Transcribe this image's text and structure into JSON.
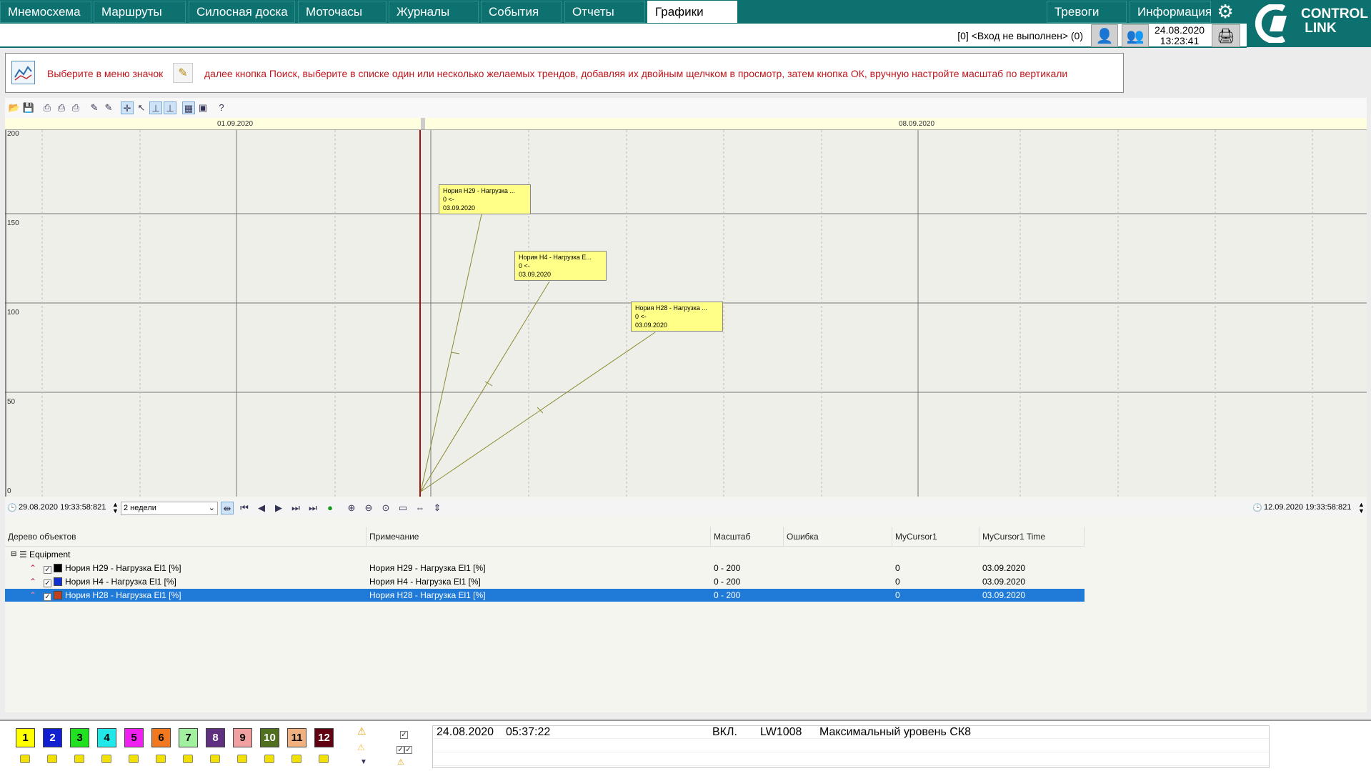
{
  "nav": {
    "tabs": [
      {
        "label": "Мнемосхема"
      },
      {
        "label": "Маршруты"
      },
      {
        "label": "Силосная доска"
      },
      {
        "label": "Моточасы"
      },
      {
        "label": "Журналы"
      },
      {
        "label": "События"
      },
      {
        "label": "Отчеты"
      },
      {
        "label": "Графики"
      }
    ],
    "right_tabs": [
      {
        "label": "Тревоги"
      },
      {
        "label": "Информация"
      }
    ],
    "logo": "CONTROL LINK"
  },
  "status": {
    "login": "[0] <Вход не выполнен> (0)",
    "date": "24.08.2020",
    "time": "13:23:41"
  },
  "hint": {
    "part1": "Выберите в меню значок",
    "part2": "далее кнопка Поиск, выберите в списке один или несколько желаемых трендов, добавляя их двойным щелчком в просмотр, затем кнопка ОК, вручную настройте масштаб по вертикали"
  },
  "chart": {
    "time_labels": [
      "01.09.2020",
      "08.09.2020"
    ],
    "y_ticks": [
      "200",
      "150",
      "100",
      "50",
      "0"
    ],
    "tooltips": [
      {
        "title": "Нория Н29 - Нагрузка ...",
        "value": "0 <-",
        "date": "03.09.2020"
      },
      {
        "title": "Нория Н4 - Нагрузка E...",
        "value": "0 <-",
        "date": "03.09.2020"
      },
      {
        "title": "Нория Н28 - Нагрузка ...",
        "value": "0 <-",
        "date": "03.09.2020"
      }
    ]
  },
  "timectl": {
    "start": "29.08.2020 19:33:58:821",
    "period": "2 недели",
    "end": "12.09.2020 19:33:58:821"
  },
  "table": {
    "headers": [
      "Дерево объектов",
      "Примечание",
      "Масштаб",
      "Ошибка",
      "MyCursor1",
      "MyCursor1 Time"
    ],
    "root": "Equipment",
    "rows": [
      {
        "name": "Нория Н29 - Нагрузка El1 [%]",
        "note": "Нория Н29 - Нагрузка El1 [%]",
        "scale": "0 - 200",
        "error": "",
        "cursor": "0",
        "cursor_time": "03.09.2020",
        "color": "#000000"
      },
      {
        "name": "Нория Н4 - Нагрузка El1 [%]",
        "note": "Нория Н4 - Нагрузка El1 [%]",
        "scale": "0 - 200",
        "error": "",
        "cursor": "0",
        "cursor_time": "03.09.2020",
        "color": "#1030d0"
      },
      {
        "name": "Нория Н28 - Нагрузка El1 [%]",
        "note": "Нория Н28 - Нагрузка El1 [%]",
        "scale": "0 - 200",
        "error": "",
        "cursor": "0",
        "cursor_time": "03.09.2020",
        "color": "#c04020"
      }
    ]
  },
  "footer": {
    "buttons": [
      {
        "label": "1",
        "bg": "#ffff00",
        "fg": "#000"
      },
      {
        "label": "2",
        "bg": "#1020d0",
        "fg": "#fff"
      },
      {
        "label": "3",
        "bg": "#20e020",
        "fg": "#000"
      },
      {
        "label": "4",
        "bg": "#20e8e8",
        "fg": "#000"
      },
      {
        "label": "5",
        "bg": "#f020f0",
        "fg": "#000"
      },
      {
        "label": "6",
        "bg": "#f07820",
        "fg": "#000"
      },
      {
        "label": "7",
        "bg": "#a0f0a0",
        "fg": "#000"
      },
      {
        "label": "8",
        "bg": "#603080",
        "fg": "#fff"
      },
      {
        "label": "9",
        "bg": "#f0a0a0",
        "fg": "#000"
      },
      {
        "label": "10",
        "bg": "#507020",
        "fg": "#fff"
      },
      {
        "label": "11",
        "bg": "#f0b080",
        "fg": "#000"
      },
      {
        "label": "12",
        "bg": "#600010",
        "fg": "#fff"
      }
    ],
    "alarm": {
      "date": "24.08.2020",
      "time": "05:37:22",
      "state": "ВКЛ.",
      "tag": "LW1008",
      "text": "Максимальный уровень СК8"
    }
  }
}
